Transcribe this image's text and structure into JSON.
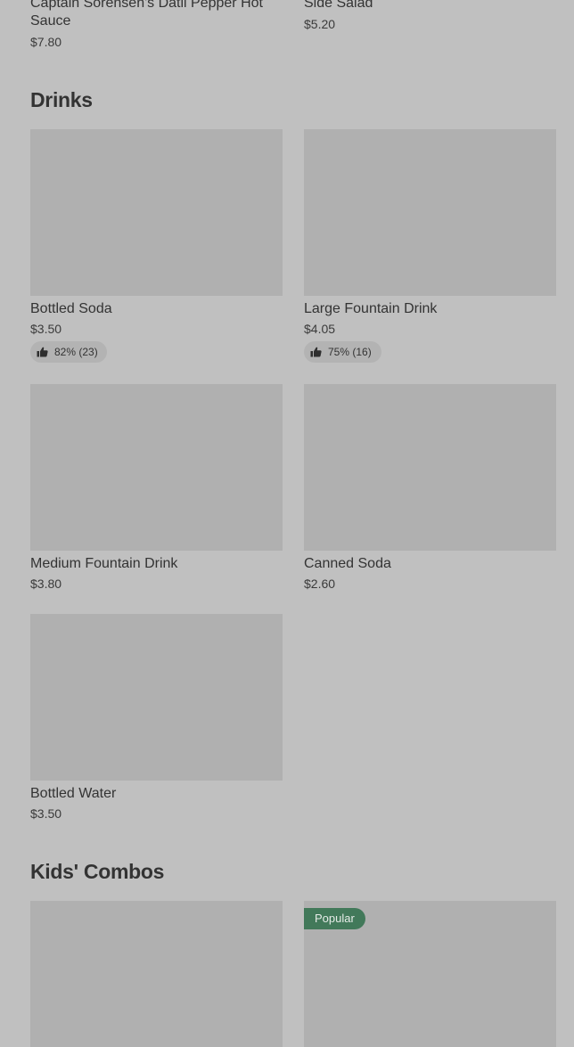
{
  "top_items": [
    {
      "name": "Captain Sorensen's Datil Pepper Hot Sauce",
      "price": "$7.80"
    },
    {
      "name": "Side Salad",
      "price": "$5.20"
    }
  ],
  "sections": [
    {
      "title": "Drinks",
      "items": [
        {
          "name": "Bottled Soda",
          "price": "$3.50",
          "rating": "82% (23)"
        },
        {
          "name": "Large Fountain Drink",
          "price": "$4.05",
          "rating": "75% (16)"
        },
        {
          "name": "Medium Fountain Drink",
          "price": "$3.80"
        },
        {
          "name": "Canned Soda",
          "price": "$2.60"
        },
        {
          "name": "Bottled Water",
          "price": "$3.50"
        }
      ]
    },
    {
      "title": "Kids' Combos",
      "items": [
        {
          "name": "",
          "price": ""
        },
        {
          "name": "",
          "price": "",
          "badge": "Popular"
        }
      ]
    }
  ],
  "icons": {
    "rating": "thumbs-up-icon"
  },
  "colors": {
    "background": "#c0c0c0",
    "image_placeholder": "#b0b0b0",
    "popular_badge": "#42795a"
  }
}
